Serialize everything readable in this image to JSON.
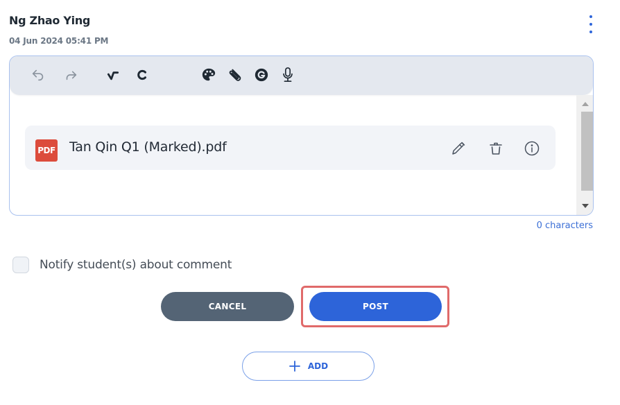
{
  "comment": {
    "author": "Ng Zhao Ying",
    "timestamp": "04 Jun 2024 05:41 PM"
  },
  "toolbar": {
    "buttons": [
      {
        "name": "undo",
        "icon": "undo-icon"
      },
      {
        "name": "redo",
        "icon": "redo-icon"
      },
      {
        "name": "checkmark",
        "icon": "tick-mark-icon"
      },
      {
        "name": "c-mark",
        "icon": "c-letter-icon"
      },
      {
        "name": "palette",
        "icon": "palette-icon"
      },
      {
        "name": "attach",
        "icon": "paperclip-icon"
      },
      {
        "name": "grammarly",
        "icon": "g-logo-icon"
      },
      {
        "name": "microphone",
        "icon": "microphone-icon"
      }
    ]
  },
  "attachment": {
    "badge": "PDF",
    "file_name": "Tan Qin Q1 (Marked).pdf",
    "actions": [
      "edit-pencil-icon",
      "trash-icon",
      "info-icon"
    ]
  },
  "editor": {
    "char_count": "0 characters"
  },
  "notify": {
    "label": "Notify student(s) about comment",
    "checked": false
  },
  "actions": {
    "cancel_label": "CANCEL",
    "post_label": "POST",
    "add_label": "ADD"
  },
  "colors": {
    "primary": "#2d64d9",
    "cancel": "#546475",
    "highlight": "#e06a6a",
    "pdf": "#dc4c3c"
  }
}
